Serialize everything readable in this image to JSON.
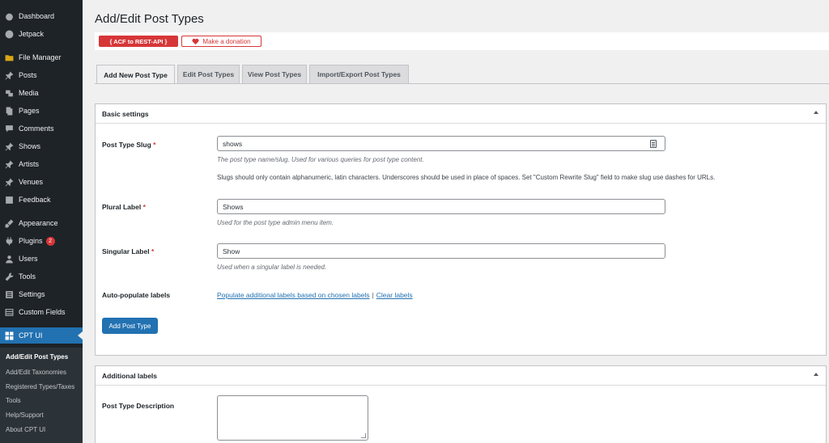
{
  "sidebar": {
    "items": [
      {
        "label": "Dashboard",
        "icon": "dashboard-icon"
      },
      {
        "label": "Jetpack",
        "icon": "jetpack-icon"
      },
      {
        "label": "File Manager",
        "icon": "folder-icon"
      },
      {
        "label": "Posts",
        "icon": "pin-icon"
      },
      {
        "label": "Media",
        "icon": "media-icon"
      },
      {
        "label": "Pages",
        "icon": "pages-icon"
      },
      {
        "label": "Comments",
        "icon": "comment-icon"
      },
      {
        "label": "Shows",
        "icon": "pin-icon"
      },
      {
        "label": "Artists",
        "icon": "pin-icon"
      },
      {
        "label": "Venues",
        "icon": "pin-icon"
      },
      {
        "label": "Feedback",
        "icon": "feedback-icon"
      },
      {
        "label": "Appearance",
        "icon": "brush-icon"
      },
      {
        "label": "Plugins",
        "icon": "plugin-icon",
        "badge": "2"
      },
      {
        "label": "Users",
        "icon": "users-icon"
      },
      {
        "label": "Tools",
        "icon": "wrench-icon"
      },
      {
        "label": "Settings",
        "icon": "settings-icon"
      },
      {
        "label": "Custom Fields",
        "icon": "custom-fields-icon"
      },
      {
        "label": "CPT UI",
        "icon": "cptui-icon"
      }
    ],
    "submenu": [
      "Add/Edit Post Types",
      "Add/Edit Taxonomies",
      "Registered Types/Taxes",
      "Tools",
      "Help/Support",
      "About CPT UI"
    ]
  },
  "header": {
    "title": "Add/Edit Post Types",
    "acf_label": "{ ACF to REST-API }",
    "donate_label": "Make a donation"
  },
  "tabs": [
    "Add New Post Type",
    "Edit Post Types",
    "View Post Types",
    "Import/Export Post Types"
  ],
  "basic": {
    "title": "Basic settings",
    "slug_label": "Post Type Slug",
    "slug_value": "shows",
    "slug_help": "The post type name/slug. Used for various queries for post type content.",
    "slug_note": "Slugs should only contain alphanumeric, latin characters. Underscores should be used in place of spaces. Set \"Custom Rewrite Slug\" field to make slug use dashes for URLs.",
    "plural_label": "Plural Label",
    "plural_value": "Shows",
    "plural_help": "Used for the post type admin menu item.",
    "singular_label": "Singular Label",
    "singular_value": "Show",
    "singular_help": "Used when a singular label is needed.",
    "auto_label": "Auto-populate labels",
    "populate_link": "Populate additional labels based on chosen labels",
    "separator": "|",
    "clear_link": "Clear labels",
    "add_button": "Add Post Type",
    "required_mark": "*"
  },
  "additional": {
    "title": "Additional labels",
    "desc_label": "Post Type Description"
  },
  "colors": {
    "sidebar_bg": "#1d2327",
    "accent": "#2271b1",
    "danger": "#d63638"
  }
}
